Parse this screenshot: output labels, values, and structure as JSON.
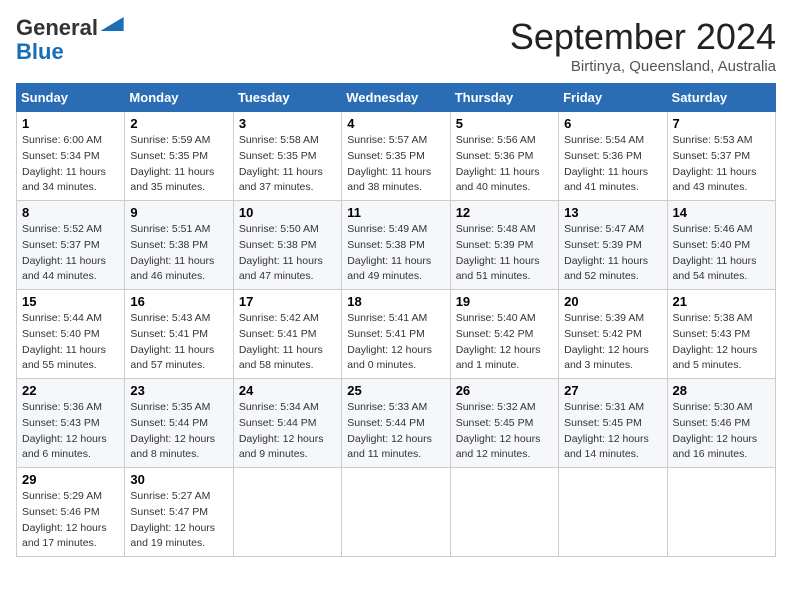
{
  "logo": {
    "line1": "General",
    "line2": "Blue"
  },
  "header": {
    "month": "September 2024",
    "location": "Birtinya, Queensland, Australia"
  },
  "weekdays": [
    "Sunday",
    "Monday",
    "Tuesday",
    "Wednesday",
    "Thursday",
    "Friday",
    "Saturday"
  ],
  "weeks": [
    [
      {
        "day": "1",
        "sunrise": "6:00 AM",
        "sunset": "5:34 PM",
        "daylight": "11 hours and 34 minutes."
      },
      {
        "day": "2",
        "sunrise": "5:59 AM",
        "sunset": "5:35 PM",
        "daylight": "11 hours and 35 minutes."
      },
      {
        "day": "3",
        "sunrise": "5:58 AM",
        "sunset": "5:35 PM",
        "daylight": "11 hours and 37 minutes."
      },
      {
        "day": "4",
        "sunrise": "5:57 AM",
        "sunset": "5:35 PM",
        "daylight": "11 hours and 38 minutes."
      },
      {
        "day": "5",
        "sunrise": "5:56 AM",
        "sunset": "5:36 PM",
        "daylight": "11 hours and 40 minutes."
      },
      {
        "day": "6",
        "sunrise": "5:54 AM",
        "sunset": "5:36 PM",
        "daylight": "11 hours and 41 minutes."
      },
      {
        "day": "7",
        "sunrise": "5:53 AM",
        "sunset": "5:37 PM",
        "daylight": "11 hours and 43 minutes."
      }
    ],
    [
      {
        "day": "8",
        "sunrise": "5:52 AM",
        "sunset": "5:37 PM",
        "daylight": "11 hours and 44 minutes."
      },
      {
        "day": "9",
        "sunrise": "5:51 AM",
        "sunset": "5:38 PM",
        "daylight": "11 hours and 46 minutes."
      },
      {
        "day": "10",
        "sunrise": "5:50 AM",
        "sunset": "5:38 PM",
        "daylight": "11 hours and 47 minutes."
      },
      {
        "day": "11",
        "sunrise": "5:49 AM",
        "sunset": "5:38 PM",
        "daylight": "11 hours and 49 minutes."
      },
      {
        "day": "12",
        "sunrise": "5:48 AM",
        "sunset": "5:39 PM",
        "daylight": "11 hours and 51 minutes."
      },
      {
        "day": "13",
        "sunrise": "5:47 AM",
        "sunset": "5:39 PM",
        "daylight": "11 hours and 52 minutes."
      },
      {
        "day": "14",
        "sunrise": "5:46 AM",
        "sunset": "5:40 PM",
        "daylight": "11 hours and 54 minutes."
      }
    ],
    [
      {
        "day": "15",
        "sunrise": "5:44 AM",
        "sunset": "5:40 PM",
        "daylight": "11 hours and 55 minutes."
      },
      {
        "day": "16",
        "sunrise": "5:43 AM",
        "sunset": "5:41 PM",
        "daylight": "11 hours and 57 minutes."
      },
      {
        "day": "17",
        "sunrise": "5:42 AM",
        "sunset": "5:41 PM",
        "daylight": "11 hours and 58 minutes."
      },
      {
        "day": "18",
        "sunrise": "5:41 AM",
        "sunset": "5:41 PM",
        "daylight": "12 hours and 0 minutes."
      },
      {
        "day": "19",
        "sunrise": "5:40 AM",
        "sunset": "5:42 PM",
        "daylight": "12 hours and 1 minute."
      },
      {
        "day": "20",
        "sunrise": "5:39 AM",
        "sunset": "5:42 PM",
        "daylight": "12 hours and 3 minutes."
      },
      {
        "day": "21",
        "sunrise": "5:38 AM",
        "sunset": "5:43 PM",
        "daylight": "12 hours and 5 minutes."
      }
    ],
    [
      {
        "day": "22",
        "sunrise": "5:36 AM",
        "sunset": "5:43 PM",
        "daylight": "12 hours and 6 minutes."
      },
      {
        "day": "23",
        "sunrise": "5:35 AM",
        "sunset": "5:44 PM",
        "daylight": "12 hours and 8 minutes."
      },
      {
        "day": "24",
        "sunrise": "5:34 AM",
        "sunset": "5:44 PM",
        "daylight": "12 hours and 9 minutes."
      },
      {
        "day": "25",
        "sunrise": "5:33 AM",
        "sunset": "5:44 PM",
        "daylight": "12 hours and 11 minutes."
      },
      {
        "day": "26",
        "sunrise": "5:32 AM",
        "sunset": "5:45 PM",
        "daylight": "12 hours and 12 minutes."
      },
      {
        "day": "27",
        "sunrise": "5:31 AM",
        "sunset": "5:45 PM",
        "daylight": "12 hours and 14 minutes."
      },
      {
        "day": "28",
        "sunrise": "5:30 AM",
        "sunset": "5:46 PM",
        "daylight": "12 hours and 16 minutes."
      }
    ],
    [
      {
        "day": "29",
        "sunrise": "5:29 AM",
        "sunset": "5:46 PM",
        "daylight": "12 hours and 17 minutes."
      },
      {
        "day": "30",
        "sunrise": "5:27 AM",
        "sunset": "5:47 PM",
        "daylight": "12 hours and 19 minutes."
      },
      null,
      null,
      null,
      null,
      null
    ]
  ]
}
